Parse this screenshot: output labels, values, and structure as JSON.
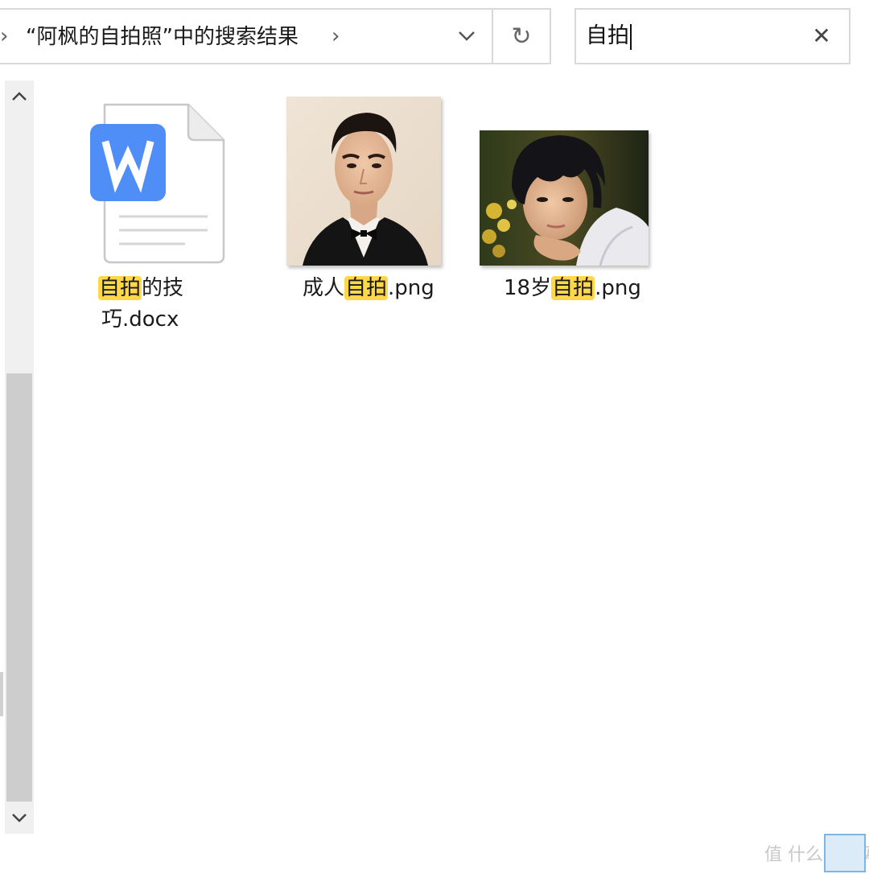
{
  "address_bar": {
    "breadcrumb": "“阿枫的自拍照”中的搜索结果",
    "chevron_left": "›",
    "chevron_mid": "›",
    "refresh_glyph": "↻"
  },
  "search": {
    "value": "自拍",
    "clear_glyph": "✕"
  },
  "files": [
    {
      "name_line1_highlight": "自拍",
      "name_line1_rest": "的技",
      "name_line2": "巧.docx",
      "icon": "word-doc-icon"
    },
    {
      "name_prefix": "成人",
      "name_highlight": "自拍",
      "name_suffix": ".png"
    },
    {
      "name_prefix": "18岁",
      "name_highlight": "自拍",
      "name_suffix": ".png"
    }
  ],
  "doc_icon_letter": "W",
  "watermark": "值 什么值得买",
  "colors": {
    "highlight": "#ffd84a",
    "word_blue": "#4f8ef7",
    "border": "#d9d9d9",
    "scroll_thumb": "#cdcdcd"
  }
}
